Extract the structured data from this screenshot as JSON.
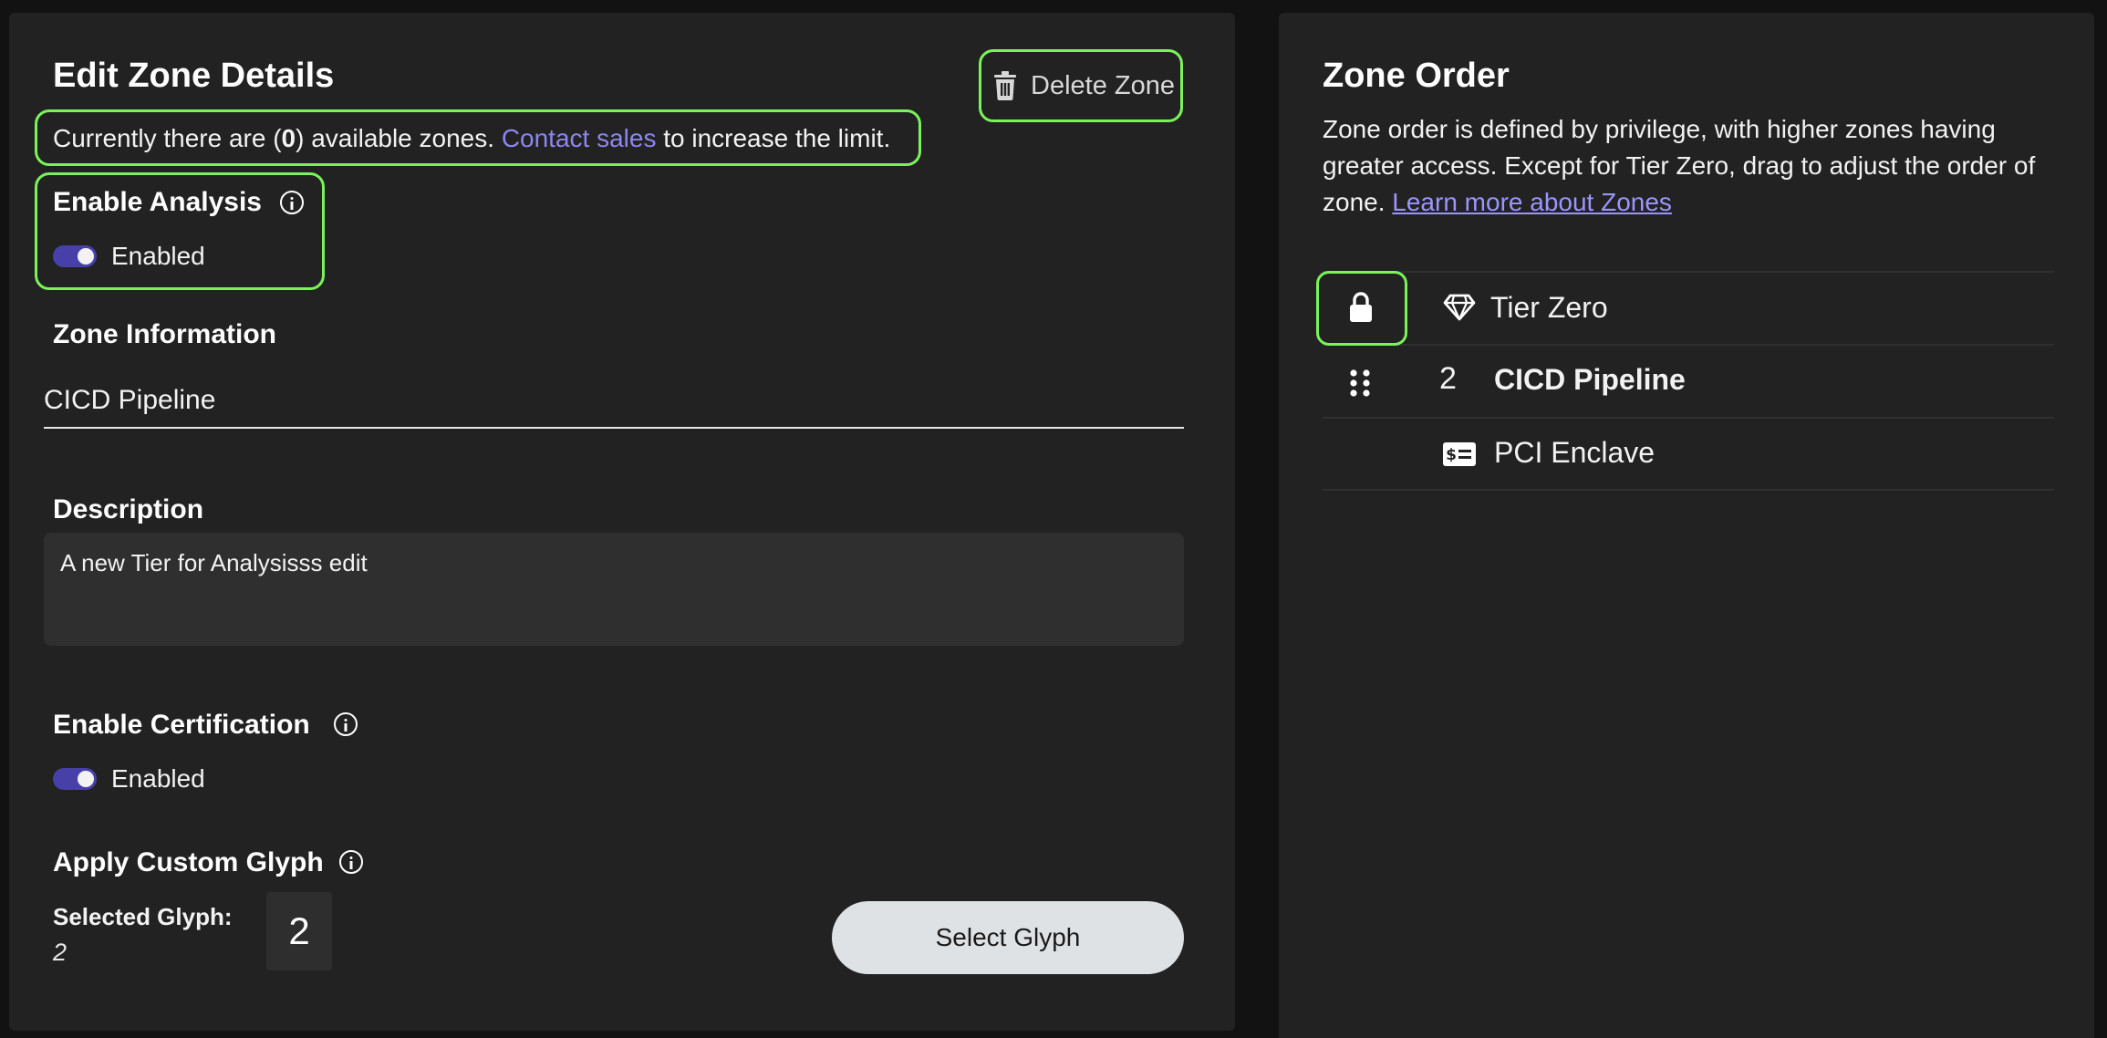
{
  "edit": {
    "title": "Edit Zone Details",
    "delete_label": "Delete Zone",
    "availability": {
      "prefix": "Currently there are (",
      "count": "0",
      "middle": ") available zones. ",
      "link": "Contact sales",
      "suffix": " to increase the limit."
    },
    "analysis": {
      "title": "Enable Analysis",
      "toggle_label": "Enabled"
    },
    "zone_info": {
      "title": "Zone Information",
      "name_value": "CICD Pipeline"
    },
    "description": {
      "title": "Description",
      "value": "A new Tier for Analysisss edit"
    },
    "certification": {
      "title": "Enable Certification",
      "toggle_label": "Enabled"
    },
    "glyph": {
      "title": "Apply Custom Glyph",
      "selected_label": "Selected Glyph:",
      "selected_value": "2",
      "preview": "2",
      "button_label": "Select Glyph"
    }
  },
  "order": {
    "title": "Zone Order",
    "description": "Zone order is defined by privilege, with higher zones having greater access. Except for Tier Zero, drag to adjust the order of zone. ",
    "learn_more": "Learn more about Zones",
    "rows": [
      {
        "name": "Tier Zero",
        "icon": "gem-icon",
        "locked": true
      },
      {
        "number": "2",
        "name": "CICD Pipeline",
        "icon": "drag-handle-icon"
      },
      {
        "name": "PCI Enclave",
        "icon": "money-card-icon"
      }
    ]
  },
  "colors": {
    "highlight": "#7af35a",
    "toggle_on": "#4740a8",
    "link": "#8c86f0"
  }
}
